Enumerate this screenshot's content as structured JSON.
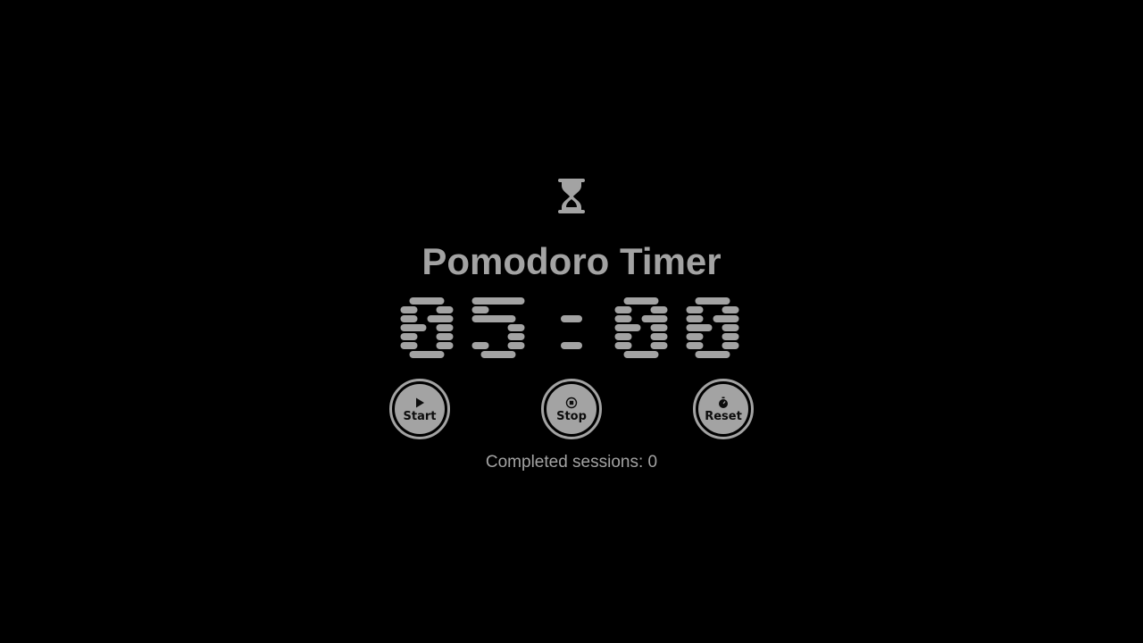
{
  "app": {
    "title": "Pomodoro Timer",
    "icon": "hourglass-icon"
  },
  "timer": {
    "display": "05:00",
    "minutes": "05",
    "seconds": "00"
  },
  "controls": {
    "start": {
      "label": "Start",
      "icon": "play-icon"
    },
    "stop": {
      "label": "Stop",
      "icon": "stop-icon"
    },
    "reset": {
      "label": "Reset",
      "icon": "stopwatch-icon"
    }
  },
  "sessions": {
    "text": "Completed sessions: 0"
  },
  "colors": {
    "background": "#000000",
    "foreground": "#a3a3a3"
  }
}
